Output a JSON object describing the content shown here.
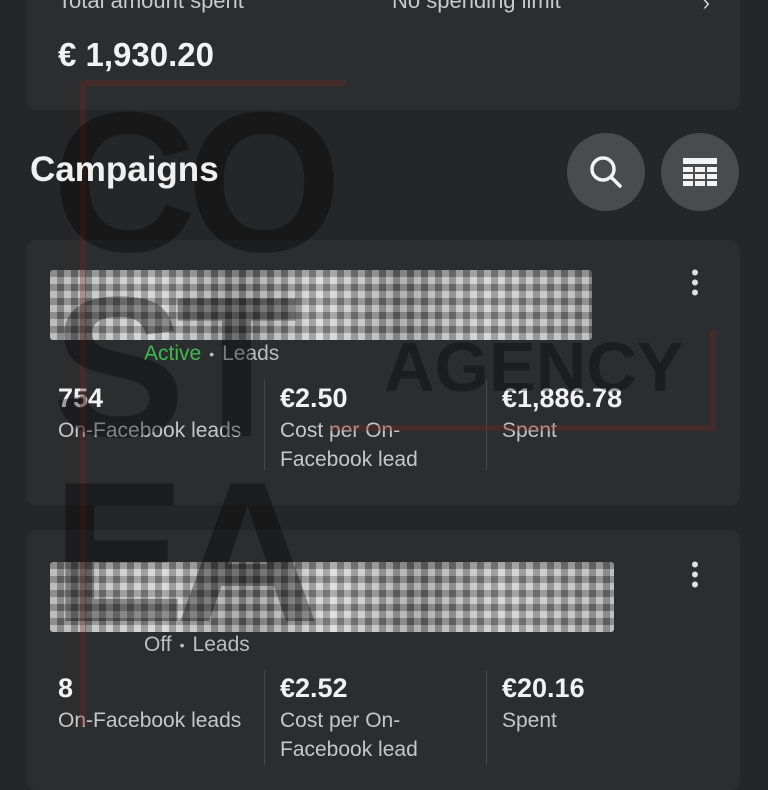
{
  "summary": {
    "total_label": "Total amount spent",
    "limit_label": "No spending limit",
    "total_value": "€ 1,930.20"
  },
  "watermark": {
    "logo_text_left": "CO ST EA",
    "logo_text_right": "AGENCY"
  },
  "campaigns_title": "Campaigns",
  "campaigns": [
    {
      "status": "Active",
      "objective": "Leads",
      "metrics": [
        {
          "value": "754",
          "label": "On-Facebook leads"
        },
        {
          "value": "€2.50",
          "label": "Cost per On-Facebook lead"
        },
        {
          "value": "€1,886.78",
          "label": "Spent"
        }
      ]
    },
    {
      "status": "Off",
      "objective": "Leads",
      "metrics": [
        {
          "value": "8",
          "label": "On-Facebook leads"
        },
        {
          "value": "€2.52",
          "label": "Cost per On-Facebook lead"
        },
        {
          "value": "€20.16",
          "label": "Spent"
        }
      ]
    }
  ],
  "colors": {
    "active": "#3fb950",
    "background": "#252627"
  },
  "icons": [
    "chevron-right-icon",
    "search-icon",
    "table-icon",
    "more-vertical-icon"
  ]
}
